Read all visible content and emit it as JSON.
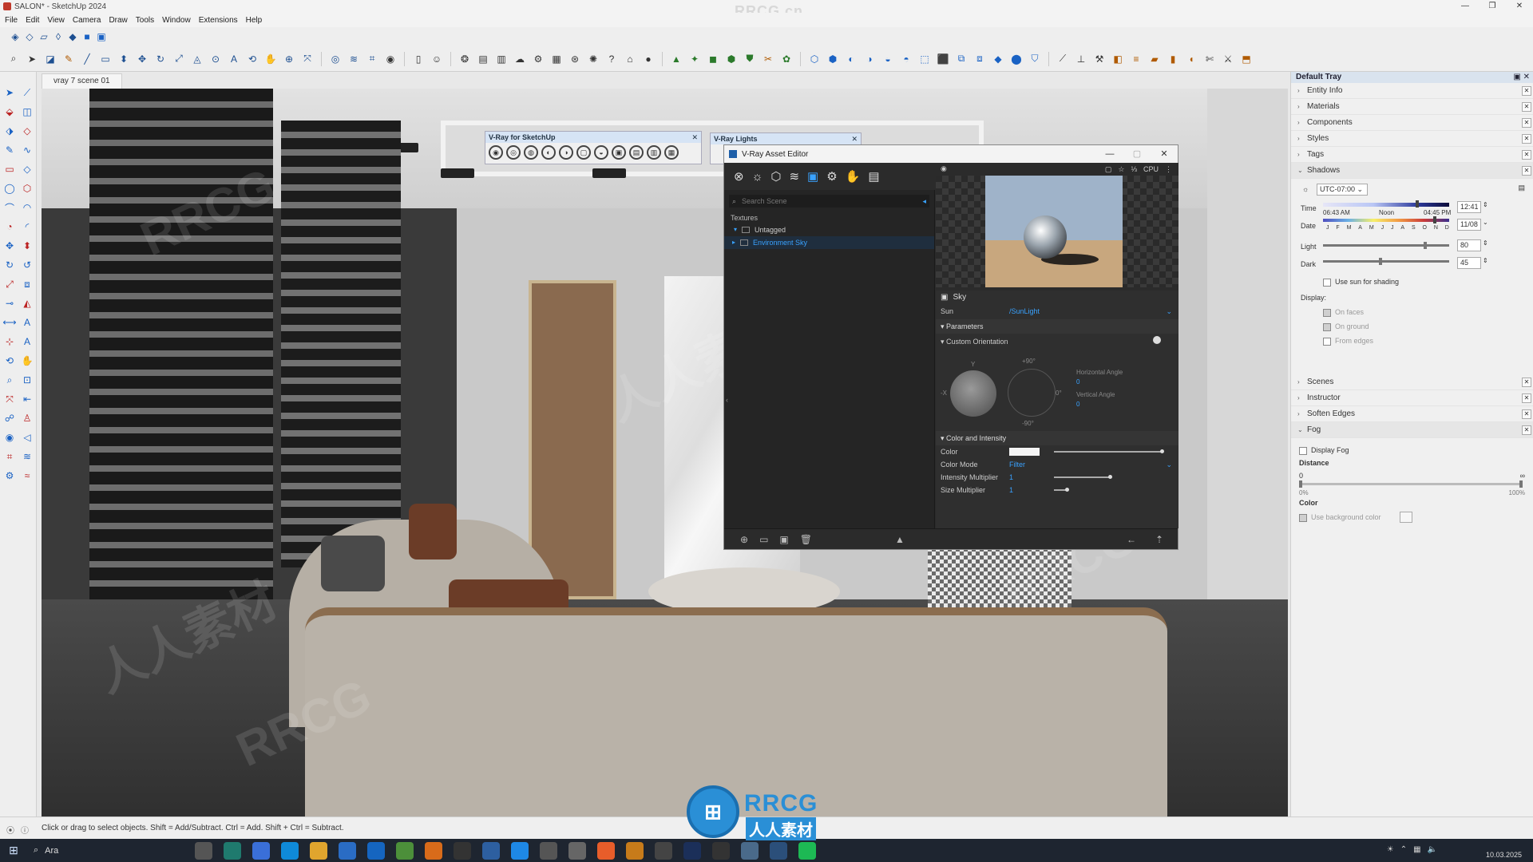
{
  "app": {
    "title": "SALON* - SketchUp 2024",
    "watermark_top": "RRCG.cn"
  },
  "menu": [
    "File",
    "Edit",
    "View",
    "Camera",
    "Draw",
    "Tools",
    "Window",
    "Extensions",
    "Help"
  ],
  "scene_tab": "vray 7 scene 01",
  "mini_toolbars": {
    "vray_sketchup": "V-Ray for SketchUp",
    "vray_lights": "V-Ray Lights"
  },
  "asset_editor": {
    "title": "V-Ray Asset Editor",
    "search_placeholder": "Search Scene",
    "section": "Textures",
    "tree": [
      {
        "label": "Untagged",
        "selected": false
      },
      {
        "label": "Environment Sky",
        "selected": true
      }
    ],
    "preview_mode": "CPU",
    "props": {
      "header": "Sky",
      "sun_label": "Sun",
      "sun_value": "/SunLight",
      "parameters": "Parameters",
      "custom_orientation": "Custom Orientation",
      "horizontal_angle_label": "Horizontal Angle",
      "horizontal_angle_value": "0",
      "vertical_angle_label": "Vertical Angle",
      "vertical_angle_value": "0",
      "plus90": "+90°",
      "minus90": "-90°",
      "axis_y": "Y",
      "axis_x": "-X",
      "axis_zero": "0°",
      "color_and_intensity": "Color and Intensity",
      "color_label": "Color",
      "color_mode_label": "Color Mode",
      "color_mode_value": "Filter",
      "intensity_label": "Intensity Multiplier",
      "intensity_value": "1",
      "size_label": "Size Multiplier",
      "size_value": "1"
    }
  },
  "tray": {
    "title": "Default Tray",
    "panels_top": [
      "Entity Info",
      "Materials",
      "Components",
      "Styles",
      "Tags"
    ],
    "shadows": {
      "title": "Shadows",
      "timezone": "UTC-07:00",
      "time_label": "Time",
      "time_start": "06:43 AM",
      "time_noon": "Noon",
      "time_end": "04:45 PM",
      "time_value": "12:41",
      "date_label": "Date",
      "months": [
        "J",
        "F",
        "M",
        "A",
        "M",
        "J",
        "J",
        "A",
        "S",
        "O",
        "N",
        "D"
      ],
      "date_value": "11/08",
      "light_label": "Light",
      "light_value": "80",
      "dark_label": "Dark",
      "dark_value": "45",
      "use_sun": "Use sun for shading",
      "display_label": "Display:",
      "on_faces": "On faces",
      "on_ground": "On ground",
      "from_edges": "From edges"
    },
    "panels_mid": [
      "Scenes",
      "Instructor",
      "Soften Edges"
    ],
    "fog": {
      "title": "Fog",
      "display_fog": "Display Fog",
      "distance_label": "Distance",
      "dist_min": "0",
      "dist_max": "∞",
      "pct_min": "0%",
      "pct_max": "100%",
      "color_label": "Color",
      "use_bg": "Use background color"
    }
  },
  "statusbar": {
    "text": "Click or drag to select objects. Shift = Add/Subtract. Ctrl = Add. Shift + Ctrl = Subtract."
  },
  "taskbar": {
    "search": "Ara",
    "time": "",
    "date": "10.03.2025"
  },
  "logo": {
    "main": "RRCG",
    "sub": "人人素材"
  },
  "viewport_watermarks": [
    "RRCG",
    "人人素材",
    "RRCG",
    "人人素材",
    "RRCG"
  ]
}
